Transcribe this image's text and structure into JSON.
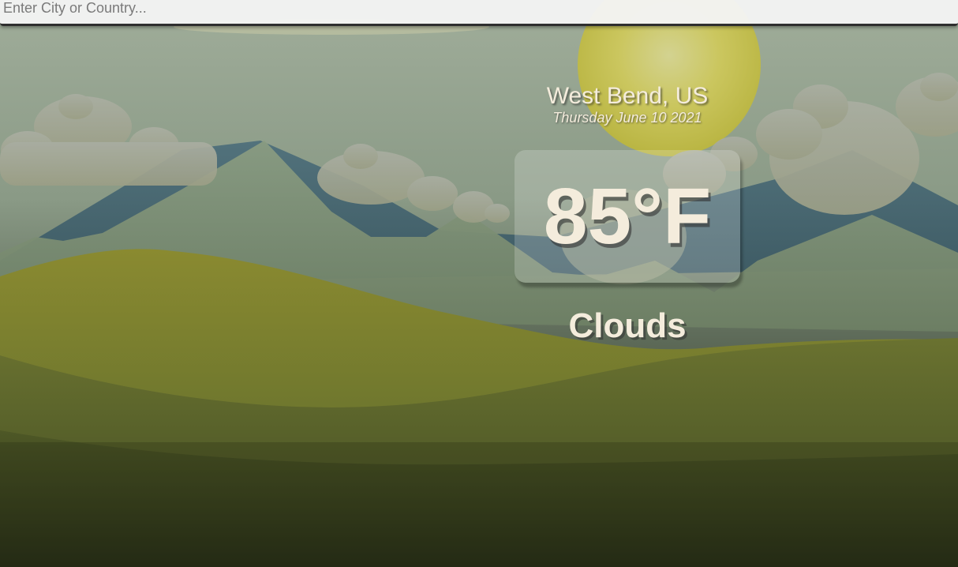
{
  "search": {
    "placeholder": "Enter City or Country...",
    "value": ""
  },
  "weather": {
    "location": "West Bend, US",
    "date": "Thursday June 10 2021",
    "temperature": "85°F",
    "condition": "Clouds"
  },
  "colors": {
    "text": "#f4ecdc",
    "sun": "#c9c44c",
    "hills": "#6b7430",
    "mountains": "#4f6b73"
  },
  "icons": {
    "background": "landscape-scene-icon",
    "sun": "sun-icon",
    "clouds": "cloud-icon"
  }
}
